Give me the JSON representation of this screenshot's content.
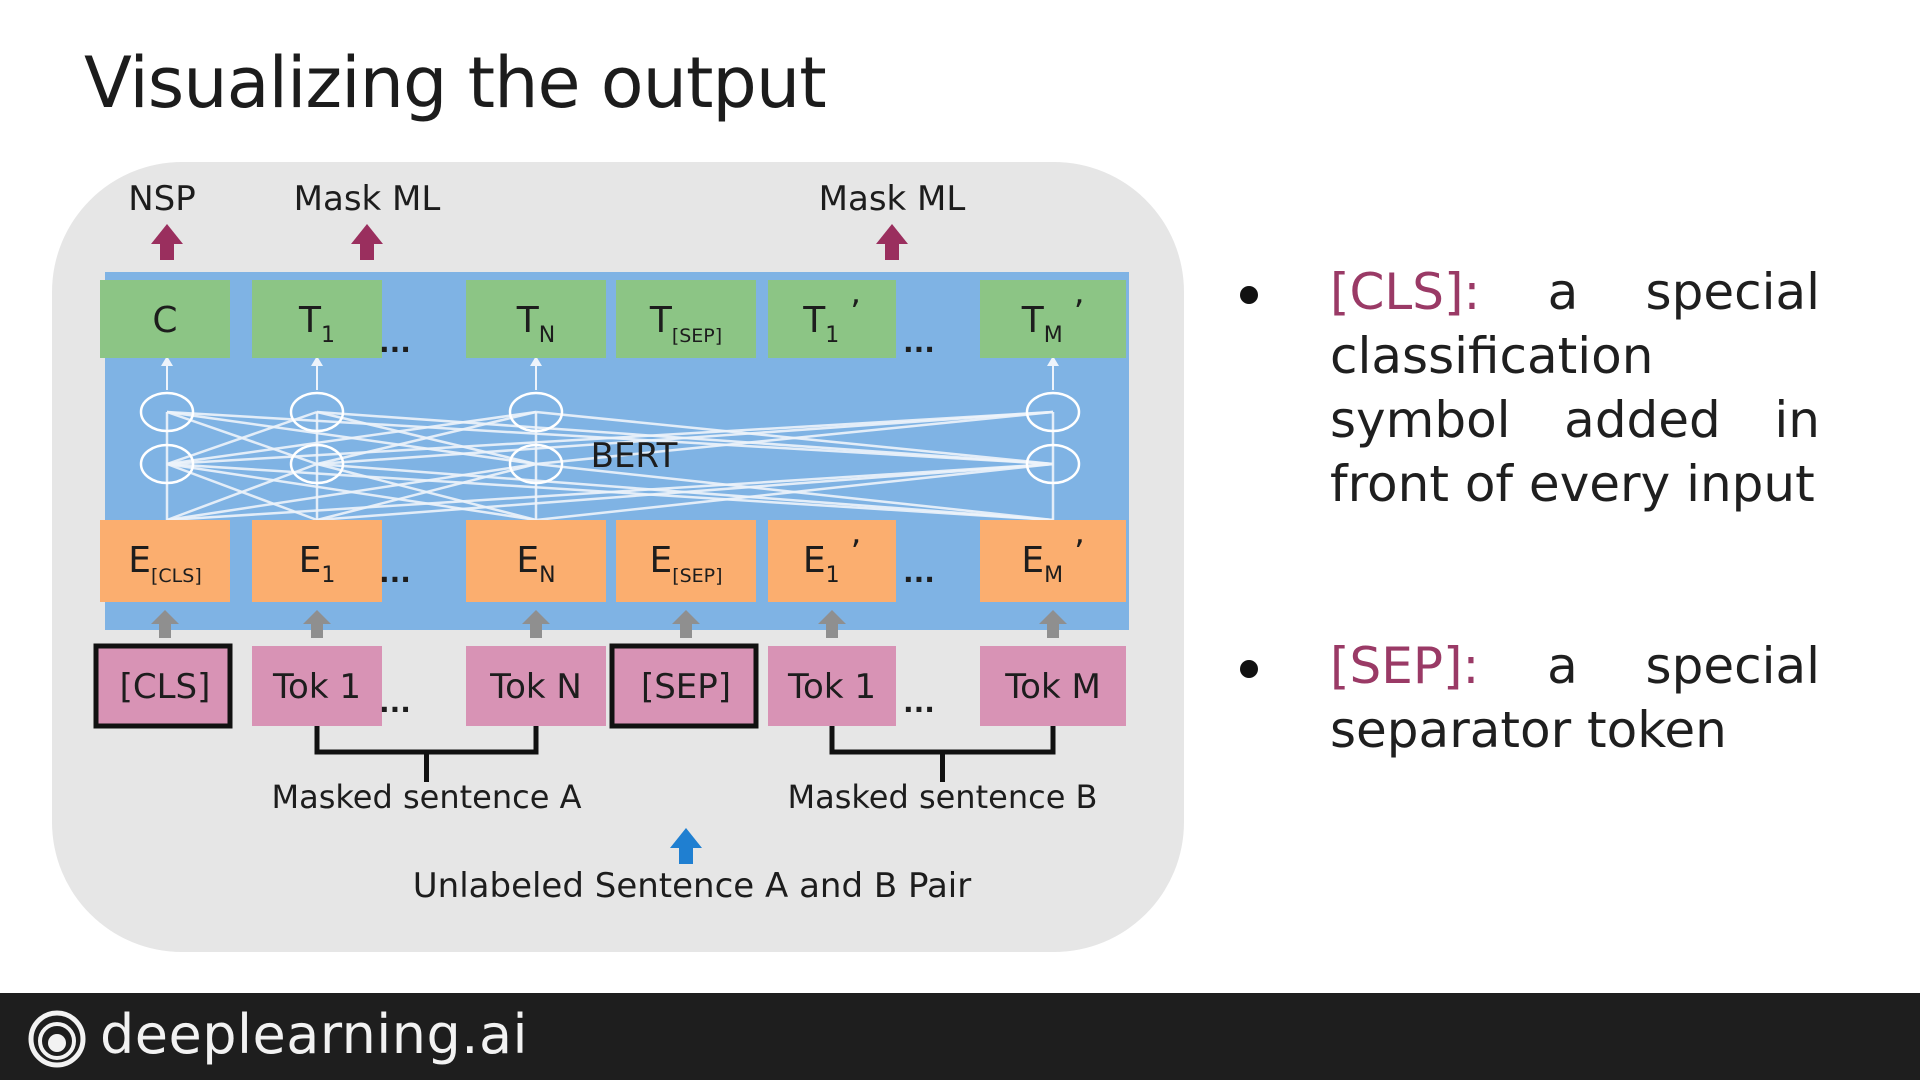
{
  "slide": {
    "title": "Visualizing the output"
  },
  "diagram": {
    "output_labels": [
      "NSP",
      "Mask ML",
      "Mask ML"
    ],
    "model_label": "BERT",
    "transformer_outputs": [
      {
        "base": "C",
        "sub": "",
        "prime": ""
      },
      {
        "base": "T",
        "sub": "1",
        "prime": ""
      },
      {
        "base": "...",
        "sub": "",
        "prime": ""
      },
      {
        "base": "T",
        "sub": "N",
        "prime": ""
      },
      {
        "base": "T",
        "sub": "[SEP]",
        "prime": ""
      },
      {
        "base": "T",
        "sub": "1",
        "prime": "’"
      },
      {
        "base": "...",
        "sub": "",
        "prime": ""
      },
      {
        "base": "T",
        "sub": "M",
        "prime": "’"
      }
    ],
    "embeddings": [
      {
        "base": "E",
        "sub": "[CLS]",
        "prime": ""
      },
      {
        "base": "E",
        "sub": "1",
        "prime": ""
      },
      {
        "base": "...",
        "sub": "",
        "prime": ""
      },
      {
        "base": "E",
        "sub": "N",
        "prime": ""
      },
      {
        "base": "E",
        "sub": "[SEP]",
        "prime": ""
      },
      {
        "base": "E",
        "sub": "1",
        "prime": "’"
      },
      {
        "base": "...",
        "sub": "",
        "prime": ""
      },
      {
        "base": "E",
        "sub": "M",
        "prime": "’"
      }
    ],
    "tokens": [
      "[CLS]",
      "Tok 1",
      "...",
      "Tok N",
      "[SEP]",
      "Tok 1",
      "...",
      "Tok M"
    ],
    "group_labels": [
      "Masked sentence A",
      "Masked sentence B"
    ],
    "input_label": "Unlabeled Sentence A and B Pair",
    "colors": {
      "panel": "#e6e6e6",
      "bert_block": "#7fb3e4",
      "output_box": "#8cc585",
      "embedding_box": "#fbae6f",
      "token_box": "#d893b5",
      "output_arrow": "#9a2f5e",
      "input_arrow": "#1f7fd1",
      "connector_arrow": "#8f8f8f"
    }
  },
  "bullets": [
    {
      "term": "[CLS]:",
      "text": "a special classification symbol added in front of every input"
    },
    {
      "term": "[SEP]:",
      "text": "a special separator token"
    }
  ],
  "footer": {
    "brand": "deeplearning.ai",
    "logo_icon": "deeplearning-logo-icon"
  }
}
